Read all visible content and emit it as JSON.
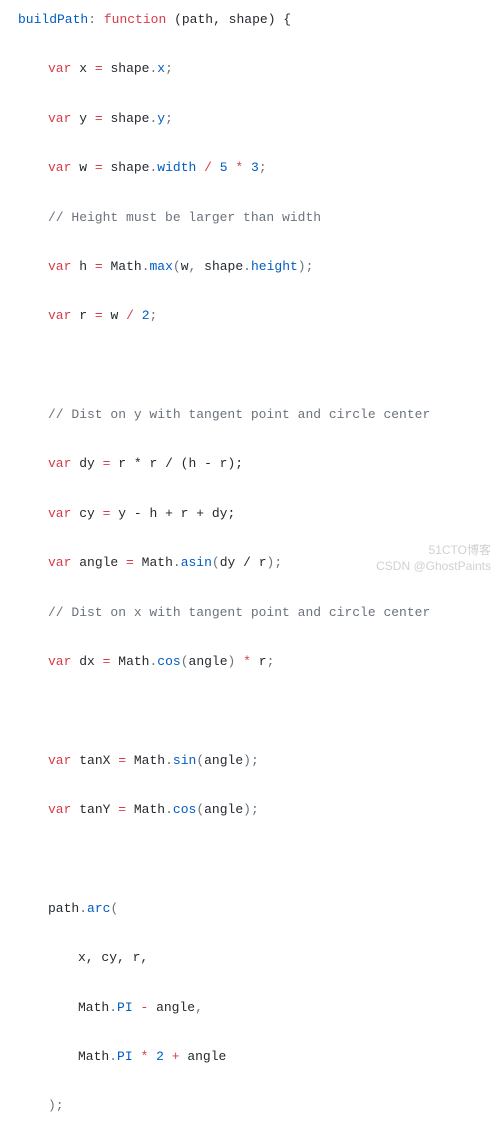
{
  "code": {
    "l1": {
      "fn": "buildPath",
      "colon": ":",
      "kw": "function",
      "params": "(path, shape) {"
    },
    "l2": {
      "kw": "var",
      "lhs": "x",
      "eq": "=",
      "obj": "shape",
      "dot": ".",
      "prop": "x",
      "end": ";"
    },
    "l3": {
      "kw": "var",
      "lhs": "y",
      "eq": "=",
      "obj": "shape",
      "dot": ".",
      "prop": "y",
      "end": ";"
    },
    "l4": {
      "kw": "var",
      "lhs": "w",
      "eq": "=",
      "obj": "shape",
      "dot": ".",
      "prop": "width",
      "op1": "/",
      "n1": "5",
      "op2": "*",
      "n2": "3",
      "end": ";"
    },
    "l5": {
      "comment": "// Height must be larger than width"
    },
    "l6": {
      "kw": "var",
      "lhs": "h",
      "eq": "=",
      "obj": "Math",
      "dot": ".",
      "fn": "max",
      "open": "(",
      "a1": "w",
      "comma": ",",
      "a2o": "shape",
      "a2d": ".",
      "a2p": "height",
      "close": ")",
      "end": ";"
    },
    "l7": {
      "kw": "var",
      "lhs": "r",
      "eq": "=",
      "rhs": "w",
      "op": "/",
      "n": "2",
      "end": ";"
    },
    "l9": {
      "comment": "// Dist on y with tangent point and circle center"
    },
    "l10": {
      "kw": "var",
      "lhs": "dy",
      "eq": "=",
      "expr": "r * r / (h - r);"
    },
    "l11": {
      "kw": "var",
      "lhs": "cy",
      "eq": "=",
      "expr": "y - h + r + dy;"
    },
    "l12": {
      "kw": "var",
      "lhs": "angle",
      "eq": "=",
      "obj": "Math",
      "dot": ".",
      "fn": "asin",
      "open": "(",
      "arg": "dy / r",
      "close": ")",
      "end": ";"
    },
    "l13": {
      "comment": "// Dist on x with tangent point and circle center"
    },
    "l14": {
      "kw": "var",
      "lhs": "dx",
      "eq": "=",
      "obj": "Math",
      "dot": ".",
      "fn": "cos",
      "open": "(",
      "arg": "angle",
      "close": ")",
      "op": "*",
      "rhs": "r",
      "end": ";"
    },
    "l16": {
      "kw": "var",
      "lhs": "tanX",
      "eq": "=",
      "obj": "Math",
      "dot": ".",
      "fn": "sin",
      "open": "(",
      "arg": "angle",
      "close": ")",
      "end": ";"
    },
    "l17": {
      "kw": "var",
      "lhs": "tanY",
      "eq": "=",
      "obj": "Math",
      "dot": ".",
      "fn": "cos",
      "open": "(",
      "arg": "angle",
      "close": ")",
      "end": ";"
    },
    "l19": {
      "obj": "path",
      "dot": ".",
      "fn": "arc",
      "open": "("
    },
    "l20": {
      "text": "x, cy, r,"
    },
    "l21": {
      "obj": "Math",
      "dot": ".",
      "prop": "PI",
      "op": "-",
      "rhs": "angle",
      "end": ","
    },
    "l22": {
      "obj": "Math",
      "dot": ".",
      "prop": "PI",
      "op1": "*",
      "n": "2",
      "op2": "+",
      "rhs": "angle"
    },
    "l23": {
      "close": ");"
    }
  },
  "watermark": {
    "line1": "51CTO博客",
    "line2": "CSDN @GhostPaints"
  }
}
